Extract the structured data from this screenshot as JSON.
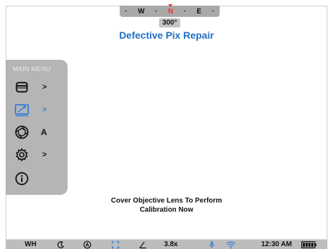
{
  "compass": {
    "dot1": "·",
    "west": "W",
    "dot2": "·",
    "north": "N",
    "dot3": "·",
    "east": "E",
    "dot4": "·"
  },
  "heading": "300°",
  "title": "Defective Pix Repair",
  "menu": {
    "title": "MAIN MENU",
    "items": [
      {
        "icon": "battery-icon",
        "arrow": ">",
        "value": ""
      },
      {
        "icon": "image-adjust-icon",
        "arrow": ">",
        "value": "",
        "selected": true
      },
      {
        "icon": "aperture-icon",
        "arrow": "",
        "value": "A"
      },
      {
        "icon": "gear-icon",
        "arrow": ">",
        "value": ""
      },
      {
        "icon": "info-icon",
        "arrow": "",
        "value": ""
      }
    ]
  },
  "message": {
    "line1": "Cover Objective Lens To Perform",
    "line2": "Calibration Now"
  },
  "status": {
    "mode": "WH",
    "zoom": "3.8x",
    "time": "12:30 AM"
  },
  "colors": {
    "accent": "#1f6fc4",
    "compass_north": "#e8322a",
    "menu_bg": "#b5b5b5",
    "status_bg": "#bdbdbd"
  }
}
